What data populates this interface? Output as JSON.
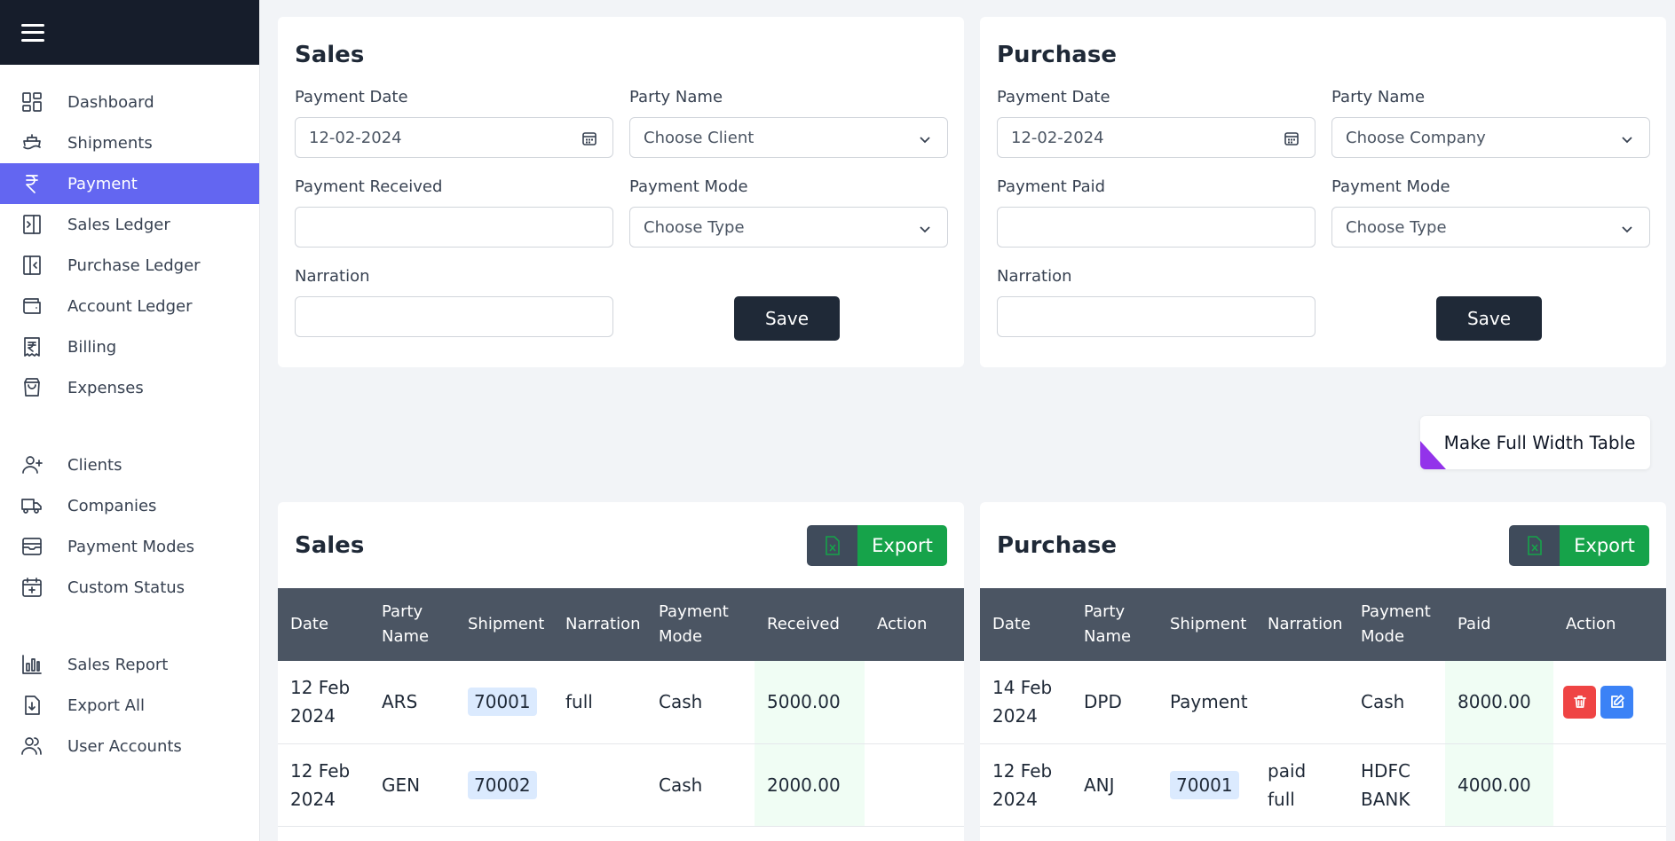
{
  "sidebar": {
    "groups": [
      [
        {
          "label": "Dashboard",
          "icon": "dashboard-icon"
        },
        {
          "label": "Shipments",
          "icon": "ship-icon"
        },
        {
          "label": "Payment",
          "icon": "rupee-icon",
          "active": true
        },
        {
          "label": "Sales Ledger",
          "icon": "ledger-in-icon"
        },
        {
          "label": "Purchase Ledger",
          "icon": "ledger-out-icon"
        },
        {
          "label": "Account Ledger",
          "icon": "wallet-icon"
        },
        {
          "label": "Billing",
          "icon": "receipt-icon"
        },
        {
          "label": "Expenses",
          "icon": "shopping-bag-icon"
        }
      ],
      [
        {
          "label": "Clients",
          "icon": "user-plus-icon"
        },
        {
          "label": "Companies",
          "icon": "truck-icon"
        },
        {
          "label": "Payment Modes",
          "icon": "archive-icon"
        },
        {
          "label": "Custom Status",
          "icon": "calendar-plus-icon"
        }
      ],
      [
        {
          "label": "Sales Report",
          "icon": "bar-chart-icon"
        },
        {
          "label": "Export All",
          "icon": "download-file-icon"
        },
        {
          "label": "User Accounts",
          "icon": "users-icon"
        }
      ]
    ]
  },
  "sales_form": {
    "title": "Sales",
    "payment_date_label": "Payment Date",
    "payment_date_value": "12-02-2024",
    "party_name_label": "Party Name",
    "party_name_value": "Choose Client",
    "amount_label": "Payment Received",
    "amount_value": "",
    "mode_label": "Payment Mode",
    "mode_value": "Choose Type",
    "narration_label": "Narration",
    "narration_value": "",
    "save_label": "Save"
  },
  "purchase_form": {
    "title": "Purchase",
    "payment_date_label": "Payment Date",
    "payment_date_value": "12-02-2024",
    "party_name_label": "Party Name",
    "party_name_value": "Choose Company",
    "amount_label": "Payment Paid",
    "amount_value": "",
    "mode_label": "Payment Mode",
    "mode_value": "Choose Type",
    "narration_label": "Narration",
    "narration_value": "",
    "save_label": "Save"
  },
  "full_width_button": "Make Full Width Table",
  "sales_table": {
    "title": "Sales",
    "export_label": "Export",
    "columns": [
      "Date",
      "Party Name",
      "Shipment",
      "Narration",
      "Payment Mode",
      "Received",
      "Action"
    ],
    "rows": [
      {
        "date": "12 Feb 2024",
        "party": "ARS",
        "shipment": "70001",
        "narration": "full",
        "mode": "Cash",
        "amount": "5000.00"
      },
      {
        "date": "12 Feb 2024",
        "party": "GEN",
        "shipment": "70002",
        "narration": "",
        "mode": "Cash",
        "amount": "2000.00"
      }
    ]
  },
  "purchase_table": {
    "title": "Purchase",
    "export_label": "Export",
    "columns": [
      "Date",
      "Party Name",
      "Shipment",
      "Narration",
      "Payment Mode",
      "Paid",
      "Action"
    ],
    "rows": [
      {
        "date": "14 Feb 2024",
        "party": "DPD",
        "shipment": "Payment",
        "shipment_badge": false,
        "narration": "",
        "mode": "Cash",
        "amount": "8000.00",
        "actions": true
      },
      {
        "date": "12 Feb 2024",
        "party": "ANJ",
        "shipment": "70001",
        "shipment_badge": true,
        "narration": "paid full",
        "mode": "HDFC BANK",
        "amount": "4000.00",
        "actions": false
      }
    ]
  },
  "colors": {
    "sidebar_header": "#161d2b",
    "active_nav": "#6366f1",
    "export_green": "#16a34a",
    "delete_red": "#ef4444",
    "edit_blue": "#3b82f6"
  }
}
